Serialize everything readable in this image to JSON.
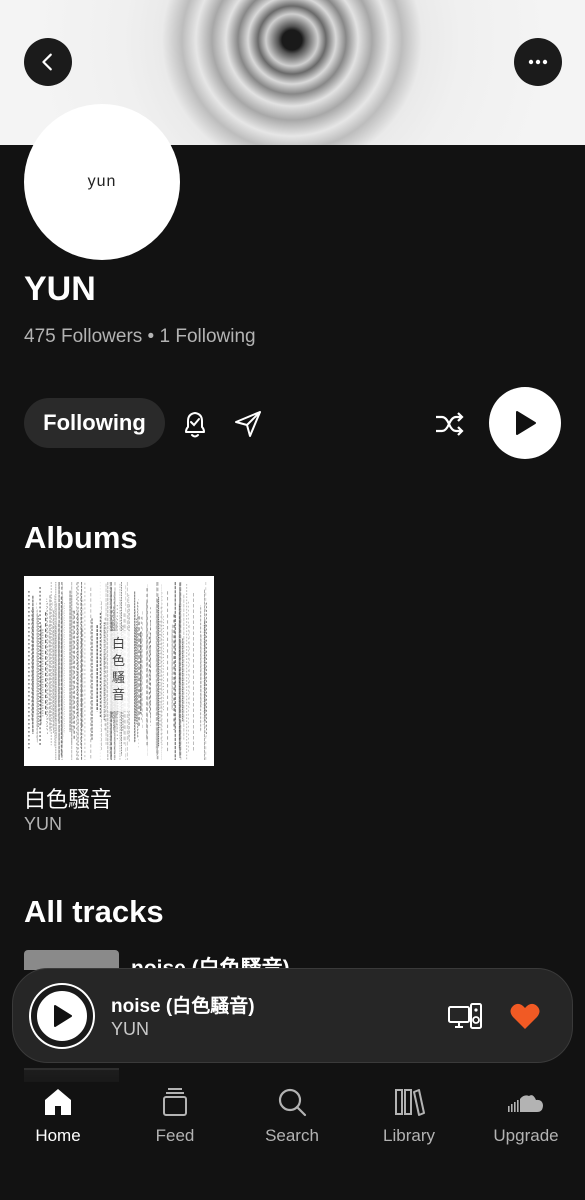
{
  "header": {
    "back_icon": "chevron-left-icon",
    "more_icon": "ellipsis-icon",
    "avatar_text": "yun"
  },
  "artist": {
    "name": "YUN",
    "stats": "475 Followers • 1 Following"
  },
  "actions": {
    "following_label": "Following",
    "bell_icon": "bell-check-icon",
    "share_icon": "send-icon",
    "shuffle_icon": "shuffle-icon",
    "play_icon": "play-icon"
  },
  "albums": {
    "title": "Albums",
    "items": [
      {
        "title": "白色騷音",
        "artist": "YUN",
        "cover_text": "白色騷音"
      }
    ]
  },
  "tracks": {
    "title": "All tracks",
    "peek_title": "noise (白色騷音)"
  },
  "player": {
    "title": "noise (白色騷音)",
    "artist": "YUN",
    "device_icon": "devices-icon",
    "like_icon": "heart-icon",
    "like_color": "#f15a24"
  },
  "tabs": [
    {
      "label": "Home",
      "icon": "home-icon",
      "active": true
    },
    {
      "label": "Feed",
      "icon": "feed-icon",
      "active": false
    },
    {
      "label": "Search",
      "icon": "search-icon",
      "active": false
    },
    {
      "label": "Library",
      "icon": "library-icon",
      "active": false
    },
    {
      "label": "Upgrade",
      "icon": "soundcloud-icon",
      "active": false
    }
  ]
}
